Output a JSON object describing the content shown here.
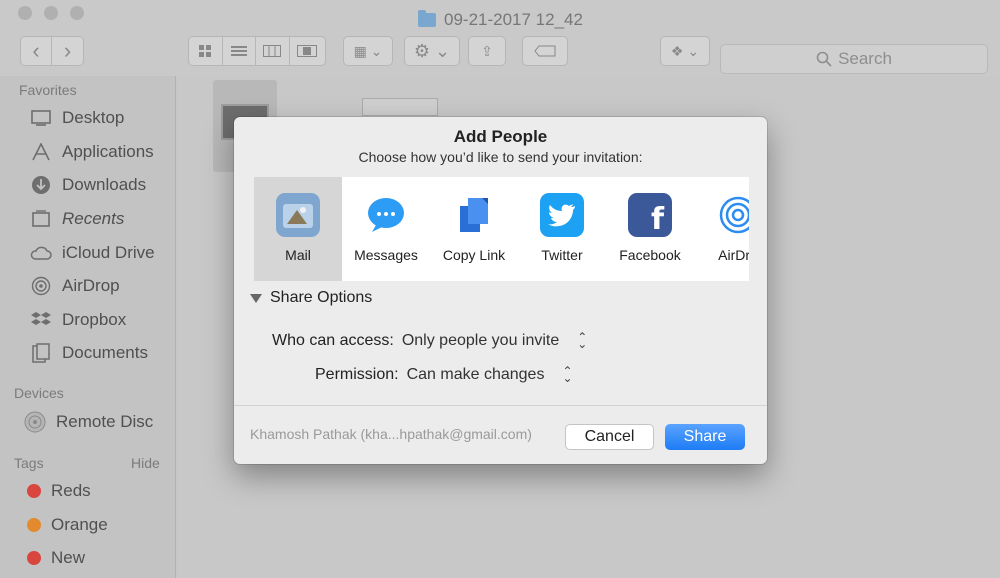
{
  "window": {
    "title": "09-21-2017 12_42"
  },
  "toolbar": {
    "back_label": "‹",
    "forward_label": "›",
    "search_placeholder": "Search"
  },
  "sidebar": {
    "favorites_heading": "Favorites",
    "favorites": [
      {
        "label": "Desktop",
        "icon": "desktop-icon"
      },
      {
        "label": "Applications",
        "icon": "applications-icon"
      },
      {
        "label": "Downloads",
        "icon": "downloads-icon"
      },
      {
        "label": "Recents",
        "icon": "recents-icon"
      },
      {
        "label": "iCloud Drive",
        "icon": "icloud-icon"
      },
      {
        "label": "AirDrop",
        "icon": "airdrop-icon"
      },
      {
        "label": "Dropbox",
        "icon": "dropbox-icon"
      },
      {
        "label": "Documents",
        "icon": "documents-icon"
      }
    ],
    "devices_heading": "Devices",
    "devices": [
      {
        "label": "Remote Disc",
        "icon": "disc-icon"
      }
    ],
    "tags_heading": "Tags",
    "tags_hide": "Hide",
    "tags": [
      {
        "label": "Reds",
        "color": "#d9463e"
      },
      {
        "label": "Orange",
        "color": "#e38a2e"
      },
      {
        "label": "New",
        "color": "#d9463e"
      }
    ]
  },
  "dialog": {
    "title": "Add People",
    "subtitle": "Choose how you’d like to send your invitation:",
    "services": [
      {
        "label": "Mail",
        "icon": "mail-icon",
        "selected": true
      },
      {
        "label": "Messages",
        "icon": "messages-icon"
      },
      {
        "label": "Copy Link",
        "icon": "copy-link-icon"
      },
      {
        "label": "Twitter",
        "icon": "twitter-icon"
      },
      {
        "label": "Facebook",
        "icon": "facebook-icon"
      },
      {
        "label": "AirDro",
        "icon": "airdrop-icon"
      }
    ],
    "share_options_label": "Share Options",
    "who_can_access_label": "Who can access:",
    "who_can_access_value": "Only people you invite",
    "permission_label": "Permission:",
    "permission_value": "Can make changes",
    "account_text": "Khamosh Pathak (kha...hpathak@gmail.com)",
    "cancel_label": "Cancel",
    "share_label": "Share"
  },
  "colors": {
    "share_button": "#1e7cf5",
    "twitter": "#1da1f2",
    "facebook": "#3b5998",
    "messages": "#2d9cf5"
  }
}
